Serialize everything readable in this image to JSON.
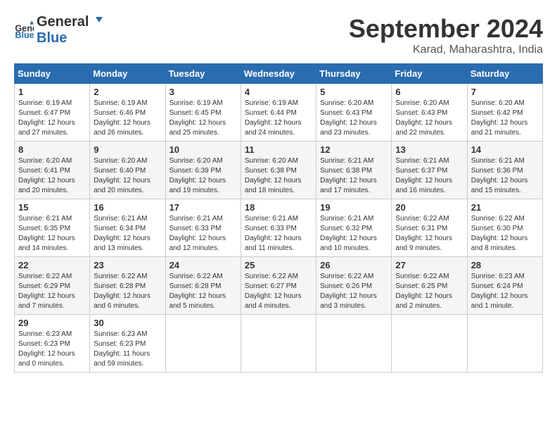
{
  "header": {
    "logo_general": "General",
    "logo_blue": "Blue",
    "month": "September 2024",
    "location": "Karad, Maharashtra, India"
  },
  "columns": [
    "Sunday",
    "Monday",
    "Tuesday",
    "Wednesday",
    "Thursday",
    "Friday",
    "Saturday"
  ],
  "weeks": [
    [
      {
        "day": "1",
        "sunrise": "Sunrise: 6:19 AM",
        "sunset": "Sunset: 6:47 PM",
        "daylight": "Daylight: 12 hours and 27 minutes."
      },
      {
        "day": "2",
        "sunrise": "Sunrise: 6:19 AM",
        "sunset": "Sunset: 6:46 PM",
        "daylight": "Daylight: 12 hours and 26 minutes."
      },
      {
        "day": "3",
        "sunrise": "Sunrise: 6:19 AM",
        "sunset": "Sunset: 6:45 PM",
        "daylight": "Daylight: 12 hours and 25 minutes."
      },
      {
        "day": "4",
        "sunrise": "Sunrise: 6:19 AM",
        "sunset": "Sunset: 6:44 PM",
        "daylight": "Daylight: 12 hours and 24 minutes."
      },
      {
        "day": "5",
        "sunrise": "Sunrise: 6:20 AM",
        "sunset": "Sunset: 6:43 PM",
        "daylight": "Daylight: 12 hours and 23 minutes."
      },
      {
        "day": "6",
        "sunrise": "Sunrise: 6:20 AM",
        "sunset": "Sunset: 6:43 PM",
        "daylight": "Daylight: 12 hours and 22 minutes."
      },
      {
        "day": "7",
        "sunrise": "Sunrise: 6:20 AM",
        "sunset": "Sunset: 6:42 PM",
        "daylight": "Daylight: 12 hours and 21 minutes."
      }
    ],
    [
      {
        "day": "8",
        "sunrise": "Sunrise: 6:20 AM",
        "sunset": "Sunset: 6:41 PM",
        "daylight": "Daylight: 12 hours and 20 minutes."
      },
      {
        "day": "9",
        "sunrise": "Sunrise: 6:20 AM",
        "sunset": "Sunset: 6:40 PM",
        "daylight": "Daylight: 12 hours and 20 minutes."
      },
      {
        "day": "10",
        "sunrise": "Sunrise: 6:20 AM",
        "sunset": "Sunset: 6:39 PM",
        "daylight": "Daylight: 12 hours and 19 minutes."
      },
      {
        "day": "11",
        "sunrise": "Sunrise: 6:20 AM",
        "sunset": "Sunset: 6:38 PM",
        "daylight": "Daylight: 12 hours and 18 minutes."
      },
      {
        "day": "12",
        "sunrise": "Sunrise: 6:21 AM",
        "sunset": "Sunset: 6:38 PM",
        "daylight": "Daylight: 12 hours and 17 minutes."
      },
      {
        "day": "13",
        "sunrise": "Sunrise: 6:21 AM",
        "sunset": "Sunset: 6:37 PM",
        "daylight": "Daylight: 12 hours and 16 minutes."
      },
      {
        "day": "14",
        "sunrise": "Sunrise: 6:21 AM",
        "sunset": "Sunset: 6:36 PM",
        "daylight": "Daylight: 12 hours and 15 minutes."
      }
    ],
    [
      {
        "day": "15",
        "sunrise": "Sunrise: 6:21 AM",
        "sunset": "Sunset: 6:35 PM",
        "daylight": "Daylight: 12 hours and 14 minutes."
      },
      {
        "day": "16",
        "sunrise": "Sunrise: 6:21 AM",
        "sunset": "Sunset: 6:34 PM",
        "daylight": "Daylight: 12 hours and 13 minutes."
      },
      {
        "day": "17",
        "sunrise": "Sunrise: 6:21 AM",
        "sunset": "Sunset: 6:33 PM",
        "daylight": "Daylight: 12 hours and 12 minutes."
      },
      {
        "day": "18",
        "sunrise": "Sunrise: 6:21 AM",
        "sunset": "Sunset: 6:33 PM",
        "daylight": "Daylight: 12 hours and 11 minutes."
      },
      {
        "day": "19",
        "sunrise": "Sunrise: 6:21 AM",
        "sunset": "Sunset: 6:32 PM",
        "daylight": "Daylight: 12 hours and 10 minutes."
      },
      {
        "day": "20",
        "sunrise": "Sunrise: 6:22 AM",
        "sunset": "Sunset: 6:31 PM",
        "daylight": "Daylight: 12 hours and 9 minutes."
      },
      {
        "day": "21",
        "sunrise": "Sunrise: 6:22 AM",
        "sunset": "Sunset: 6:30 PM",
        "daylight": "Daylight: 12 hours and 8 minutes."
      }
    ],
    [
      {
        "day": "22",
        "sunrise": "Sunrise: 6:22 AM",
        "sunset": "Sunset: 6:29 PM",
        "daylight": "Daylight: 12 hours and 7 minutes."
      },
      {
        "day": "23",
        "sunrise": "Sunrise: 6:22 AM",
        "sunset": "Sunset: 6:28 PM",
        "daylight": "Daylight: 12 hours and 6 minutes."
      },
      {
        "day": "24",
        "sunrise": "Sunrise: 6:22 AM",
        "sunset": "Sunset: 6:28 PM",
        "daylight": "Daylight: 12 hours and 5 minutes."
      },
      {
        "day": "25",
        "sunrise": "Sunrise: 6:22 AM",
        "sunset": "Sunset: 6:27 PM",
        "daylight": "Daylight: 12 hours and 4 minutes."
      },
      {
        "day": "26",
        "sunrise": "Sunrise: 6:22 AM",
        "sunset": "Sunset: 6:26 PM",
        "daylight": "Daylight: 12 hours and 3 minutes."
      },
      {
        "day": "27",
        "sunrise": "Sunrise: 6:22 AM",
        "sunset": "Sunset: 6:25 PM",
        "daylight": "Daylight: 12 hours and 2 minutes."
      },
      {
        "day": "28",
        "sunrise": "Sunrise: 6:23 AM",
        "sunset": "Sunset: 6:24 PM",
        "daylight": "Daylight: 12 hours and 1 minute."
      }
    ],
    [
      {
        "day": "29",
        "sunrise": "Sunrise: 6:23 AM",
        "sunset": "Sunset: 6:23 PM",
        "daylight": "Daylight: 12 hours and 0 minutes."
      },
      {
        "day": "30",
        "sunrise": "Sunrise: 6:23 AM",
        "sunset": "Sunset: 6:23 PM",
        "daylight": "Daylight: 11 hours and 59 minutes."
      },
      null,
      null,
      null,
      null,
      null
    ]
  ]
}
